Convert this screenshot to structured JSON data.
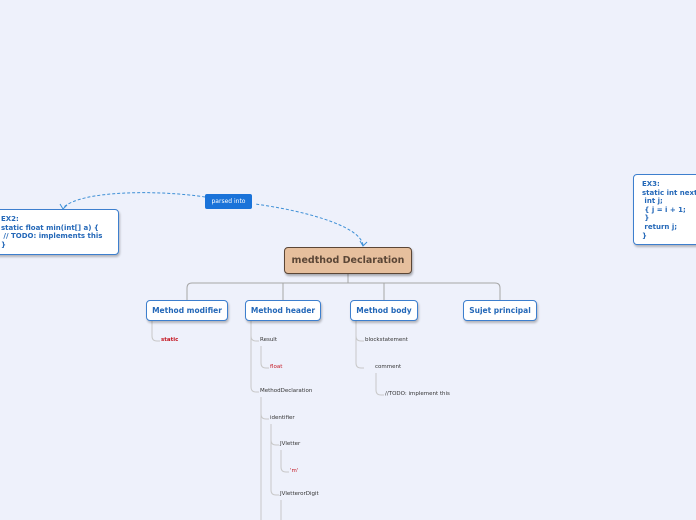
{
  "central": {
    "label": "medthod Declaration"
  },
  "relation": {
    "label": "parsed into"
  },
  "branches": [
    {
      "id": "modifier",
      "label": "Method modifier"
    },
    {
      "id": "header",
      "label": "Method header"
    },
    {
      "id": "body",
      "label": "Method body"
    },
    {
      "id": "sujet",
      "label": "Sujet principal"
    }
  ],
  "leaves": {
    "static": "static",
    "result": "Result",
    "float": "float",
    "method_declaration": "MethodDeclaration",
    "identifier": "identifier",
    "jvletter": "JVletter",
    "m": "'m'",
    "jvletterordigit": "JVletterorDigit",
    "blockstatement": "blockstatement",
    "comment": "comment",
    "todo": "//TODO: implement this"
  },
  "floating": {
    "ex2": "EX2:\nstatic float min(int[] a) {\n // TODO: implements this\n}",
    "ex3": "EX3:\nstatic int next\n int j;\n { j = i + 1;\n }\n return j;\n}"
  },
  "colors": {
    "background": "#eef1fb",
    "branch_border": "#3d7fce",
    "central_fill": "#e6bf9d",
    "relation_fill": "#1a73d9",
    "leaf_accent": "#c4141f"
  }
}
